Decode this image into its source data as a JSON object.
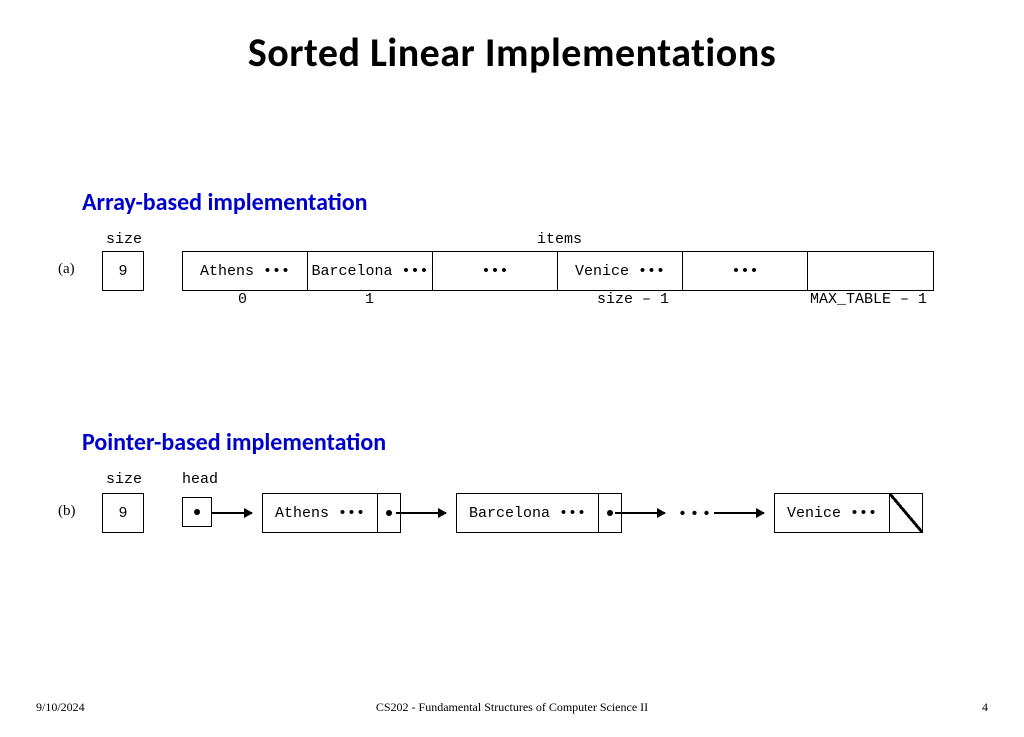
{
  "title": "Sorted Linear Implementations",
  "section_a": {
    "heading": "Array-based implementation",
    "marker": "(a)",
    "size_label": "size",
    "items_label": "items",
    "size_value": "9",
    "cells": [
      "Athens •••",
      "Barcelona •••",
      "•••",
      "Venice •••",
      "•••",
      ""
    ],
    "indices": [
      "0",
      "1",
      "size – 1",
      "MAX_TABLE – 1"
    ]
  },
  "section_b": {
    "heading": "Pointer-based implementation",
    "marker": "(b)",
    "size_label": "size",
    "head_label": "head",
    "size_value": "9",
    "nodes": [
      "Athens •••",
      "Barcelona •••",
      "Venice •••"
    ],
    "gap_dots": "•••"
  },
  "footer": {
    "date": "9/10/2024",
    "course": "CS202 - Fundamental Structures of Computer Science II",
    "page": "4"
  }
}
